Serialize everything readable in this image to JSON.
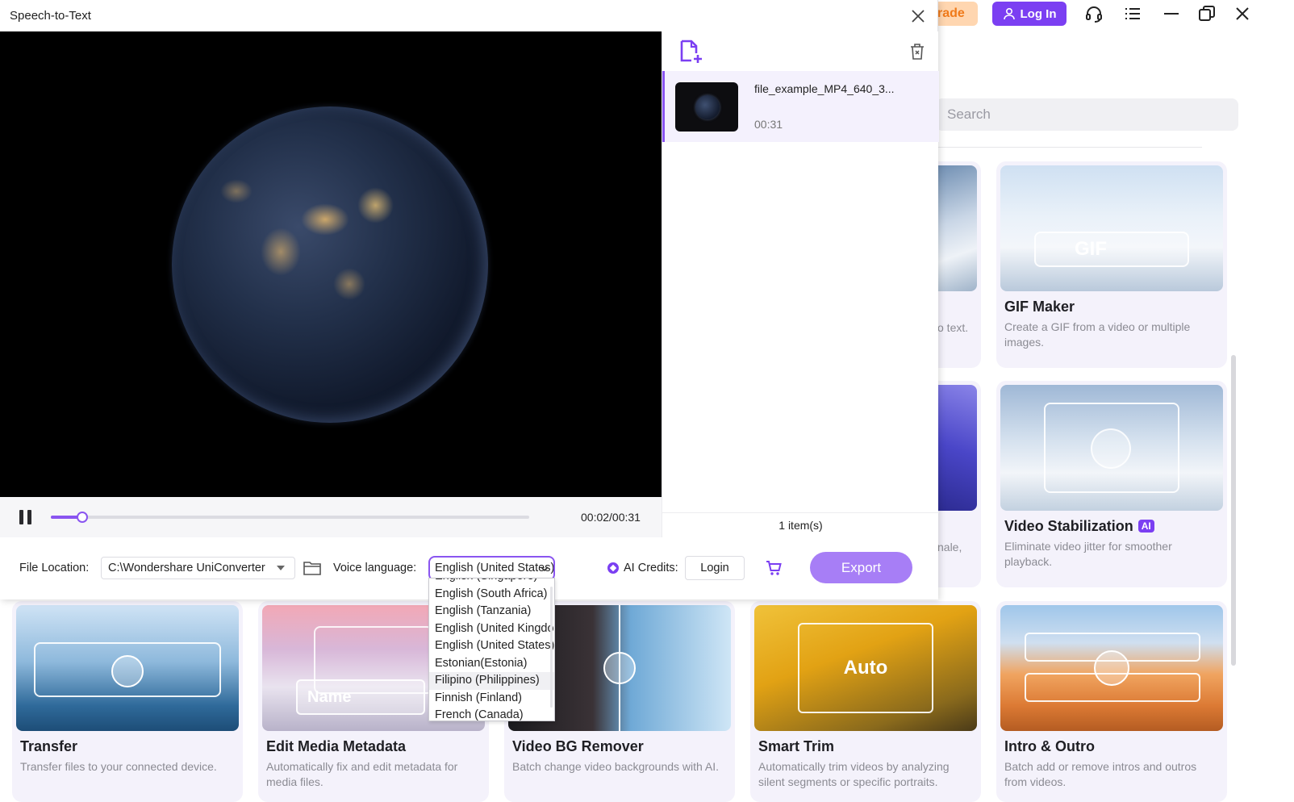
{
  "app": {
    "upgrade_label": "rade",
    "login_label": "Log In",
    "search_placeholder": "Search"
  },
  "tools_right": [
    {
      "title": "GIF Maker",
      "desc": "Create a GIF from a video or multiple images.",
      "ai": false
    },
    {
      "title": "Video Stabilization",
      "desc": "Eliminate video jitter for smoother playback.",
      "ai": true,
      "ai_label": "AI"
    }
  ],
  "partial_tools": {
    "card1_desc_fragment": "o text.",
    "card2_desc_fragment": "nale,"
  },
  "tools_bottom": [
    {
      "title": "Transfer",
      "desc": "Transfer files to your connected device."
    },
    {
      "title": "Edit Media Metadata",
      "desc": "Automatically fix and edit metadata for media files.",
      "thumb_label": "Name"
    },
    {
      "title": "Video BG Remover",
      "desc": "Batch change video backgrounds with AI."
    },
    {
      "title": "Smart Trim",
      "desc": "Automatically trim videos by analyzing silent segments or specific portraits.",
      "thumb_label": "Auto"
    },
    {
      "title": "Intro & Outro",
      "desc": "Batch add or remove intros and outros from videos."
    }
  ],
  "thumb_labels": {
    "gif": "GIF"
  },
  "dialog": {
    "title": "Speech-to-Text",
    "player": {
      "time": "00:02/00:31",
      "progress": 0.066
    },
    "files": [
      {
        "name": "file_example_MP4_640_3...",
        "duration": "00:31"
      }
    ],
    "items_count": "1 item(s)",
    "bottom": {
      "file_location_label": "File Location:",
      "file_location_value": "C:\\Wondershare UniConverter",
      "voice_language_label": "Voice language:",
      "voice_language_value": "English (United States)",
      "ai_credits_label": "AI Credits:",
      "login_label": "Login",
      "export_label": "Export"
    },
    "language_options": [
      "English (Singapore)",
      "English (South Africa)",
      "English (Tanzania)",
      "English (United Kingdom)",
      "English (United States)",
      "Estonian(Estonia)",
      "Filipino (Philippines)",
      "Finnish (Finland)",
      "French (Canada)"
    ],
    "hovered_option": "Filipino (Philippines)"
  },
  "colors": {
    "accent": "#8a55f0",
    "brand": "#7b3ff2",
    "export_bg": "#a77ef6",
    "upgrade_bg": "#ffd6b0"
  }
}
